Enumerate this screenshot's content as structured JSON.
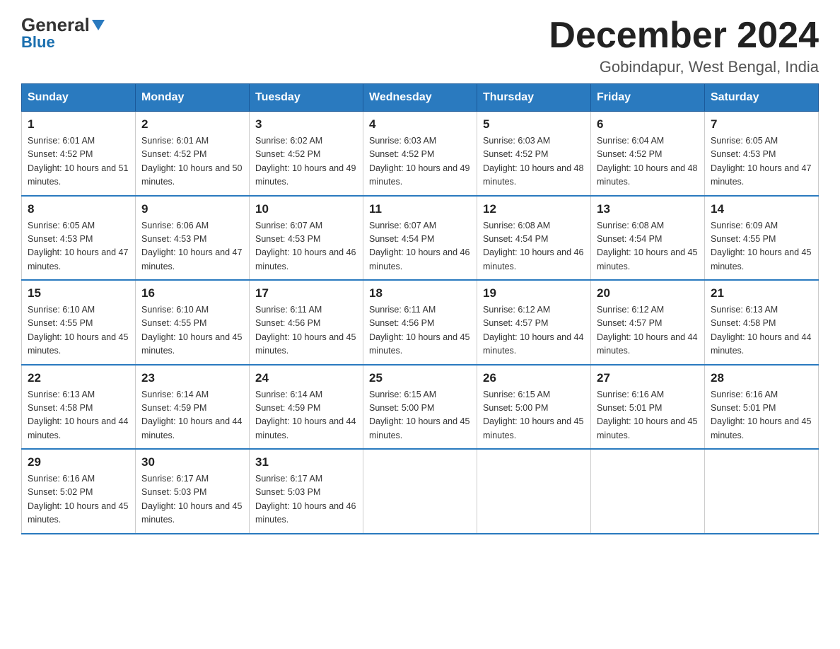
{
  "header": {
    "logo_general": "General",
    "logo_blue": "Blue",
    "month_title": "December 2024",
    "location": "Gobindapur, West Bengal, India"
  },
  "weekdays": [
    "Sunday",
    "Monday",
    "Tuesday",
    "Wednesday",
    "Thursday",
    "Friday",
    "Saturday"
  ],
  "weeks": [
    [
      {
        "day": "1",
        "sunrise": "6:01 AM",
        "sunset": "4:52 PM",
        "daylight": "10 hours and 51 minutes."
      },
      {
        "day": "2",
        "sunrise": "6:01 AM",
        "sunset": "4:52 PM",
        "daylight": "10 hours and 50 minutes."
      },
      {
        "day": "3",
        "sunrise": "6:02 AM",
        "sunset": "4:52 PM",
        "daylight": "10 hours and 49 minutes."
      },
      {
        "day": "4",
        "sunrise": "6:03 AM",
        "sunset": "4:52 PM",
        "daylight": "10 hours and 49 minutes."
      },
      {
        "day": "5",
        "sunrise": "6:03 AM",
        "sunset": "4:52 PM",
        "daylight": "10 hours and 48 minutes."
      },
      {
        "day": "6",
        "sunrise": "6:04 AM",
        "sunset": "4:52 PM",
        "daylight": "10 hours and 48 minutes."
      },
      {
        "day": "7",
        "sunrise": "6:05 AM",
        "sunset": "4:53 PM",
        "daylight": "10 hours and 47 minutes."
      }
    ],
    [
      {
        "day": "8",
        "sunrise": "6:05 AM",
        "sunset": "4:53 PM",
        "daylight": "10 hours and 47 minutes."
      },
      {
        "day": "9",
        "sunrise": "6:06 AM",
        "sunset": "4:53 PM",
        "daylight": "10 hours and 47 minutes."
      },
      {
        "day": "10",
        "sunrise": "6:07 AM",
        "sunset": "4:53 PM",
        "daylight": "10 hours and 46 minutes."
      },
      {
        "day": "11",
        "sunrise": "6:07 AM",
        "sunset": "4:54 PM",
        "daylight": "10 hours and 46 minutes."
      },
      {
        "day": "12",
        "sunrise": "6:08 AM",
        "sunset": "4:54 PM",
        "daylight": "10 hours and 46 minutes."
      },
      {
        "day": "13",
        "sunrise": "6:08 AM",
        "sunset": "4:54 PM",
        "daylight": "10 hours and 45 minutes."
      },
      {
        "day": "14",
        "sunrise": "6:09 AM",
        "sunset": "4:55 PM",
        "daylight": "10 hours and 45 minutes."
      }
    ],
    [
      {
        "day": "15",
        "sunrise": "6:10 AM",
        "sunset": "4:55 PM",
        "daylight": "10 hours and 45 minutes."
      },
      {
        "day": "16",
        "sunrise": "6:10 AM",
        "sunset": "4:55 PM",
        "daylight": "10 hours and 45 minutes."
      },
      {
        "day": "17",
        "sunrise": "6:11 AM",
        "sunset": "4:56 PM",
        "daylight": "10 hours and 45 minutes."
      },
      {
        "day": "18",
        "sunrise": "6:11 AM",
        "sunset": "4:56 PM",
        "daylight": "10 hours and 45 minutes."
      },
      {
        "day": "19",
        "sunrise": "6:12 AM",
        "sunset": "4:57 PM",
        "daylight": "10 hours and 44 minutes."
      },
      {
        "day": "20",
        "sunrise": "6:12 AM",
        "sunset": "4:57 PM",
        "daylight": "10 hours and 44 minutes."
      },
      {
        "day": "21",
        "sunrise": "6:13 AM",
        "sunset": "4:58 PM",
        "daylight": "10 hours and 44 minutes."
      }
    ],
    [
      {
        "day": "22",
        "sunrise": "6:13 AM",
        "sunset": "4:58 PM",
        "daylight": "10 hours and 44 minutes."
      },
      {
        "day": "23",
        "sunrise": "6:14 AM",
        "sunset": "4:59 PM",
        "daylight": "10 hours and 44 minutes."
      },
      {
        "day": "24",
        "sunrise": "6:14 AM",
        "sunset": "4:59 PM",
        "daylight": "10 hours and 44 minutes."
      },
      {
        "day": "25",
        "sunrise": "6:15 AM",
        "sunset": "5:00 PM",
        "daylight": "10 hours and 45 minutes."
      },
      {
        "day": "26",
        "sunrise": "6:15 AM",
        "sunset": "5:00 PM",
        "daylight": "10 hours and 45 minutes."
      },
      {
        "day": "27",
        "sunrise": "6:16 AM",
        "sunset": "5:01 PM",
        "daylight": "10 hours and 45 minutes."
      },
      {
        "day": "28",
        "sunrise": "6:16 AM",
        "sunset": "5:01 PM",
        "daylight": "10 hours and 45 minutes."
      }
    ],
    [
      {
        "day": "29",
        "sunrise": "6:16 AM",
        "sunset": "5:02 PM",
        "daylight": "10 hours and 45 minutes."
      },
      {
        "day": "30",
        "sunrise": "6:17 AM",
        "sunset": "5:03 PM",
        "daylight": "10 hours and 45 minutes."
      },
      {
        "day": "31",
        "sunrise": "6:17 AM",
        "sunset": "5:03 PM",
        "daylight": "10 hours and 46 minutes."
      },
      null,
      null,
      null,
      null
    ]
  ]
}
